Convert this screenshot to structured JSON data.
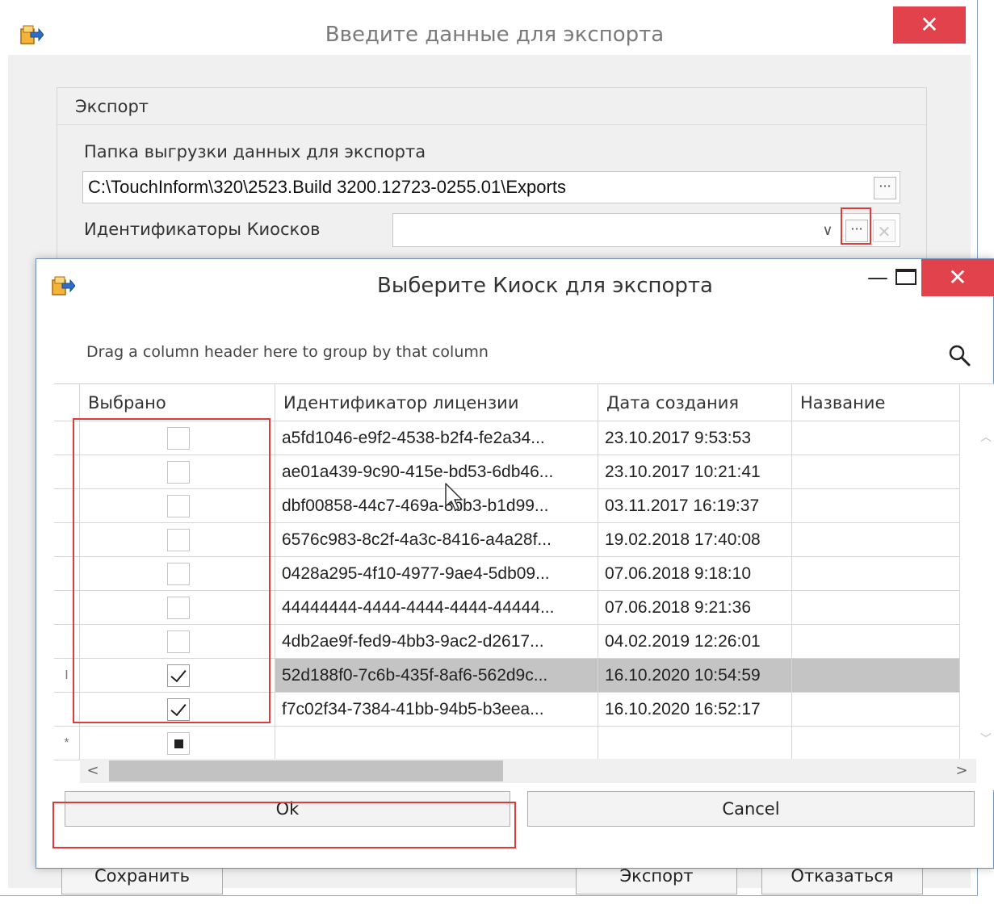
{
  "parent": {
    "title": "Введите данные для экспорта",
    "close_glyph": "✕",
    "group_title": "Экспорт",
    "folder_label": "Папка выгрузки данных для экспорта",
    "folder_value": "C:\\TouchInform\\320\\2523.Build 3200.12723-0255.01\\Exports",
    "browse_glyph": "···",
    "kiosk_label": "Идентификаторы Киосков",
    "kiosk_value": "",
    "dropdown_glyph": "∨",
    "clear_glyph": "✕",
    "buttons": {
      "save": "Сохранить",
      "export": "Экспорт",
      "refuse": "Отказаться"
    }
  },
  "dialog": {
    "title": "Выберите Киоск для экспорта",
    "minimize_glyph": "—",
    "close_glyph": "✕",
    "group_panel_text": "Drag a column header here to group by that column",
    "columns": [
      "Выбрано",
      "Идентификатор лицензии",
      "Дата создания",
      "Название"
    ],
    "rows": [
      {
        "selected": false,
        "license_id": "a5fd1046-e9f2-4538-b2f4-fe2a34...",
        "created": "23.10.2017 9:53:53",
        "name": ""
      },
      {
        "selected": false,
        "license_id": "ae01a439-9c90-415e-bd53-6db46...",
        "created": "23.10.2017 10:21:41",
        "name": ""
      },
      {
        "selected": false,
        "license_id": "dbf00858-44c7-469a-8bb3-b1d99...",
        "created": "03.11.2017 16:19:37",
        "name": ""
      },
      {
        "selected": false,
        "license_id": "6576c983-8c2f-4a3c-8416-a4a28f...",
        "created": "19.02.2018 17:40:08",
        "name": ""
      },
      {
        "selected": false,
        "license_id": "0428a295-4f10-4977-9ae4-5db09...",
        "created": "07.06.2018 9:18:10",
        "name": ""
      },
      {
        "selected": false,
        "license_id": "44444444-4444-4444-4444-44444...",
        "created": "07.06.2018 9:21:36",
        "name": ""
      },
      {
        "selected": false,
        "license_id": "4db2ae9f-fed9-4bb3-9ac2-d2617...",
        "created": "04.02.2019 12:26:01",
        "name": ""
      },
      {
        "selected": true,
        "license_id": "52d188f0-7c6b-435f-8af6-562d9c...",
        "created": "16.10.2020 10:54:59",
        "name": "",
        "current": true,
        "indicator": "I"
      },
      {
        "selected": true,
        "license_id": "f7c02f34-7384-41bb-94b5-b3eea...",
        "created": "16.10.2020 16:52:17",
        "name": ""
      }
    ],
    "new_row_indicator": "*",
    "scroll": {
      "up": "︿",
      "down": "﹀",
      "left": "<",
      "right": ">"
    },
    "buttons": {
      "ok": "Ok",
      "cancel": "Cancel"
    }
  },
  "colors": {
    "close_red": "#e2424b",
    "highlight_red": "#e03a3a",
    "selected_row": "#c4c4c4",
    "dialog_border": "#6b8fb8"
  }
}
